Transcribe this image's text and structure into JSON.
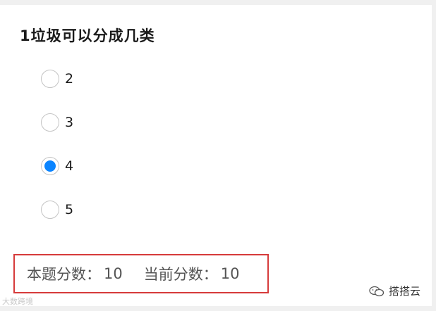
{
  "question": {
    "title": "1垃圾可以分成几类",
    "options": [
      {
        "label": "2",
        "checked": false
      },
      {
        "label": "3",
        "checked": false
      },
      {
        "label": "4",
        "checked": true
      },
      {
        "label": "5",
        "checked": false
      }
    ]
  },
  "score": {
    "question_score_label": "本题分数：",
    "question_score_value": "10",
    "current_score_label": "当前分数：",
    "current_score_value": "10",
    "highlight_color": "#d63b3b"
  },
  "watermark": {
    "left_text": "大数跨境",
    "right_text": "搭搭云",
    "right_icon": "wechat-icon"
  },
  "colors": {
    "radio_checked": "#0a84ff",
    "radio_border": "#c4c4c4"
  }
}
